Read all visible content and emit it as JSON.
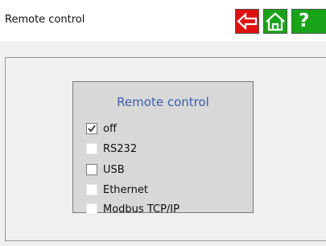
{
  "header": {
    "title": "Remote control",
    "back_icon": "arrow-left-icon",
    "home_icon": "home-icon",
    "help_label": "?",
    "colors": {
      "back": "#e01010",
      "home": "#19a319",
      "help": "#19a319"
    }
  },
  "panel": {
    "title": "Remote control",
    "options": [
      {
        "label": "off",
        "checked": true
      },
      {
        "label": "RS232",
        "checked": false
      },
      {
        "label": "USB",
        "checked": false
      },
      {
        "label": "Ethernet",
        "checked": false
      },
      {
        "label": "Modbus TCP/IP",
        "checked": false
      }
    ]
  }
}
